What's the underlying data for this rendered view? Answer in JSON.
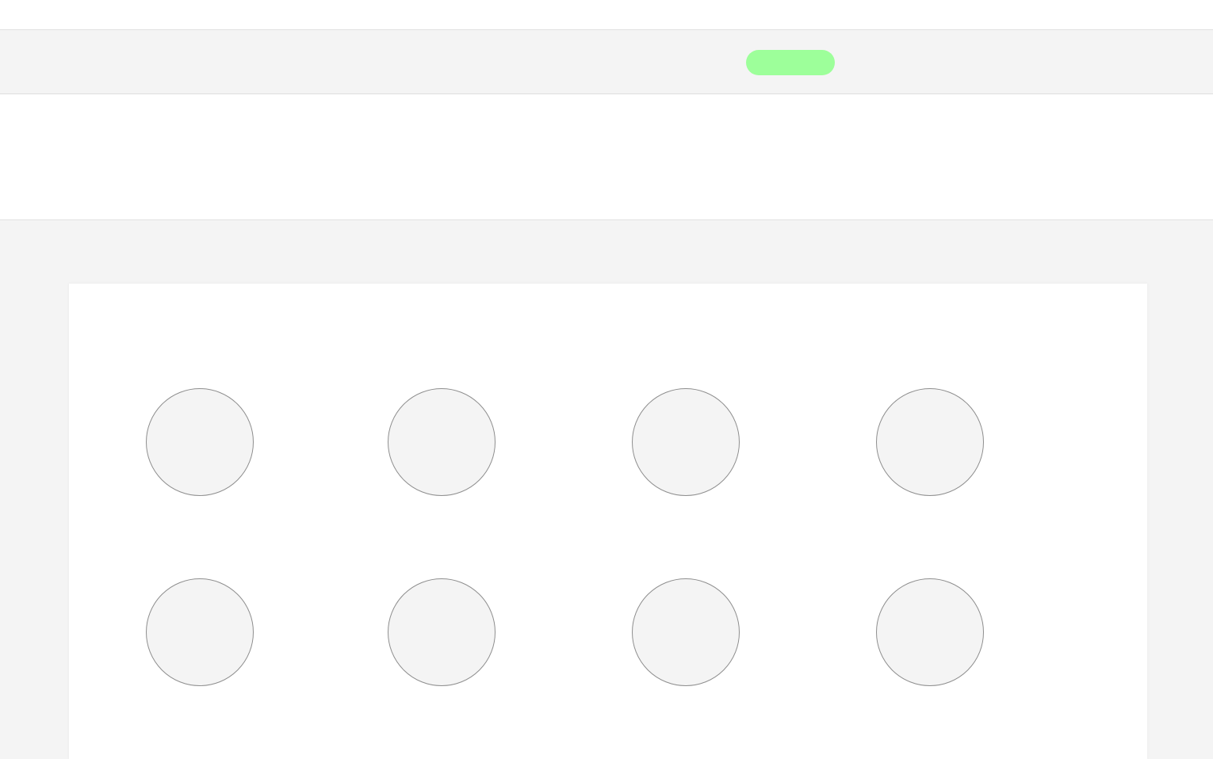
{
  "colors": {
    "page_background": "#f4f4f4",
    "panel_background": "#ffffff",
    "status_pill": "#9dff9a",
    "circle_fill": "#f4f4f4",
    "circle_border": "#8e8e8e"
  },
  "toolbar": {
    "status_pill_label": ""
  },
  "grid": {
    "items": [
      {
        "label": ""
      },
      {
        "label": ""
      },
      {
        "label": ""
      },
      {
        "label": ""
      },
      {
        "label": ""
      },
      {
        "label": ""
      },
      {
        "label": ""
      },
      {
        "label": ""
      }
    ]
  }
}
